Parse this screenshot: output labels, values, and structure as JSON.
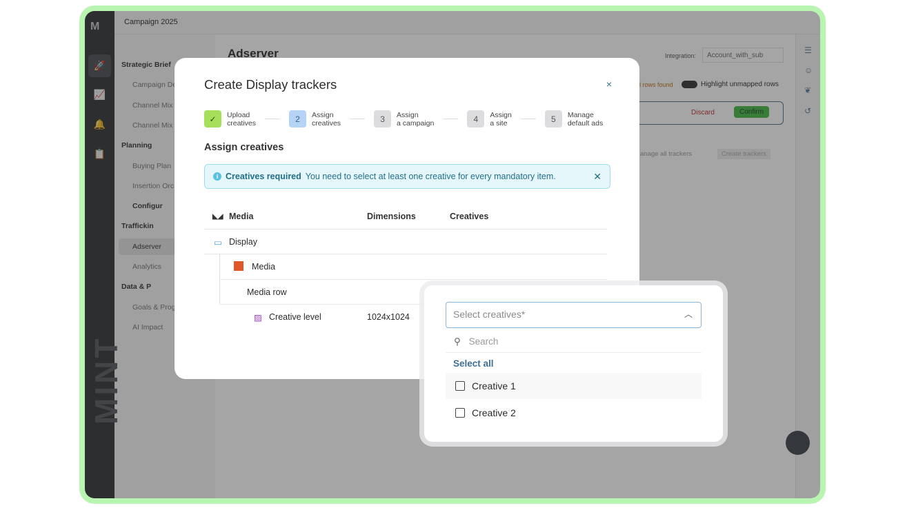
{
  "app": {
    "logo": "M",
    "brand": "MINT",
    "campaign": "Campaign 2025"
  },
  "tree": [
    {
      "label": "Strategic Brief",
      "type": "section"
    },
    {
      "label": "Campaign De",
      "type": "item"
    },
    {
      "label": "Channel Mix",
      "type": "item"
    },
    {
      "label": "Channel Mix",
      "type": "item"
    },
    {
      "label": "Planning",
      "type": "section"
    },
    {
      "label": "Buying Plan",
      "type": "item"
    },
    {
      "label": "Insertion Orc",
      "type": "item"
    },
    {
      "label": "Configur",
      "type": "section2"
    },
    {
      "label": "Traffickin",
      "type": "section"
    },
    {
      "label": "Adserver",
      "type": "selected"
    },
    {
      "label": "Analytics",
      "type": "item"
    },
    {
      "label": "Data & P",
      "type": "section"
    },
    {
      "label": "Goals & Prog",
      "type": "item"
    },
    {
      "label": "AI Impact",
      "type": "item"
    }
  ],
  "main": {
    "title": "Adserver",
    "integration_label": "Integration:",
    "integration_value": "Account_with_sub",
    "rows_found": "l rows found",
    "highlight_label": "Highlight unmapped rows",
    "discard": "Discard",
    "confirm": "Confirm",
    "manage": "anage all trackers",
    "create": "Create trackers"
  },
  "modal": {
    "title": "Create Display trackers",
    "close": "×",
    "steps": [
      {
        "num": "✓",
        "l1": "Upload",
        "l2": "creatives",
        "state": "done"
      },
      {
        "num": "2",
        "l1": "Assign",
        "l2": "creatives",
        "state": "active"
      },
      {
        "num": "3",
        "l1": "Assign",
        "l2": "a campaign",
        "state": "todo"
      },
      {
        "num": "4",
        "l1": "Assign",
        "l2": "a site",
        "state": "todo"
      },
      {
        "num": "5",
        "l1": "Manage",
        "l2": "default ads",
        "state": "todo"
      }
    ],
    "subtitle": "Assign creatives",
    "alert": {
      "title": "Creatives required",
      "text": "You need to select at least one creative for every mandatory item."
    },
    "table": {
      "headers": [
        "Media",
        "Dimensions",
        "Creatives"
      ],
      "rows": [
        {
          "name": "Display",
          "dim": ""
        },
        {
          "name": "Media",
          "dim": ""
        },
        {
          "name": "Media row",
          "dim": ""
        },
        {
          "name": "Creative level",
          "dim": "1024x1024"
        }
      ]
    }
  },
  "dropdown": {
    "placeholder": "Select creatives*",
    "search_placeholder": "Search",
    "select_all": "Select all",
    "options": [
      "Creative 1",
      "Creative 2"
    ]
  },
  "colors": {
    "accent": "#3f6f95",
    "success": "#a6e05a",
    "orange": "#e0582a",
    "frame": "#b8f5b0"
  }
}
